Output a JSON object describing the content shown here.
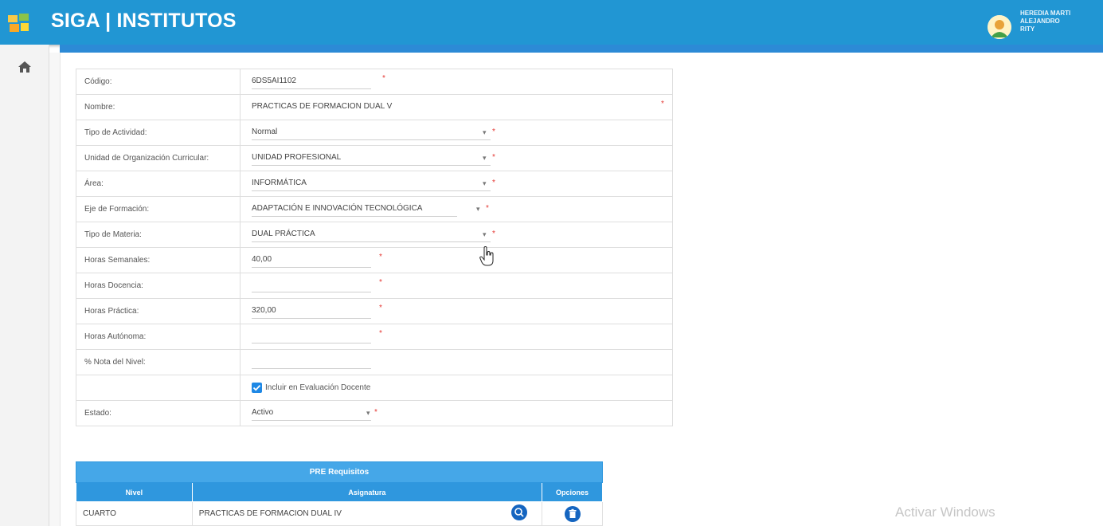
{
  "header": {
    "app_title": "SIGA | INSTITUTOS",
    "user_line1": "HEREDIA MARTI",
    "user_line2": "ALEJANDRO",
    "user_line3": "RITY",
    "color": "#2196d3"
  },
  "sidebar": {
    "home_icon": "home-icon"
  },
  "form": {
    "rows": [
      {
        "label": "Código:",
        "value": "6DS5AI1102"
      },
      {
        "label": "Nombre:",
        "value": "PRACTICAS DE FORMACION DUAL V"
      },
      {
        "label": "Tipo de Actividad:",
        "value": "Normal"
      },
      {
        "label": "Unidad de Organización Curricular:",
        "value": "UNIDAD PROFESIONAL"
      },
      {
        "label": "Área:",
        "value": "INFORMÁTICA"
      },
      {
        "label": "Eje de Formación:",
        "value": "ADAPTACIÓN E INNOVACIÓN TECNOLÓGICA"
      },
      {
        "label": "Tipo de Materia:",
        "value": "DUAL PRÁCTICA"
      },
      {
        "label": "Horas Semanales:",
        "value": "40,00"
      },
      {
        "label": "Horas Docencia:",
        "value": ""
      },
      {
        "label": "Horas Práctica:",
        "value": "320,00"
      },
      {
        "label": "Horas Autónoma:",
        "value": ""
      },
      {
        "label": "% Nota del Nivel:",
        "value": ""
      },
      {
        "label": "",
        "value": "Incluir en Evaluación Docente"
      },
      {
        "label": "Estado:",
        "value": "Activo"
      }
    ],
    "required_mark": "*"
  },
  "prereq": {
    "title": "PRE Requisitos",
    "columns": [
      "Nivel",
      "Asignatura",
      "Opciones"
    ],
    "rows": [
      {
        "nivel": "CUARTO",
        "asignatura": "PRACTICAS DE FORMACION DUAL IV"
      }
    ]
  },
  "watermark": "Activar Windows"
}
